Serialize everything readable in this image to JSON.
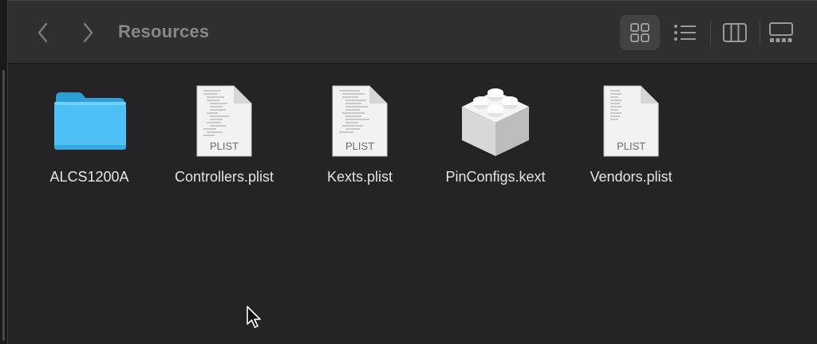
{
  "window": {
    "title": "Resources"
  },
  "toolbar": {
    "back_icon": "chevron-left-icon",
    "forward_icon": "chevron-right-icon",
    "view_buttons": [
      {
        "name": "icon-view",
        "icon": "grid-icon",
        "active": true
      },
      {
        "name": "list-view",
        "icon": "list-icon",
        "active": false
      },
      {
        "name": "column-view",
        "icon": "columns-icon",
        "active": false
      },
      {
        "name": "gallery-view",
        "icon": "gallery-icon",
        "active": false
      }
    ]
  },
  "files": [
    {
      "name": "ALCS1200A",
      "kind": "folder",
      "icon": "folder-icon"
    },
    {
      "name": "Controllers.plist",
      "kind": "plist",
      "icon": "plist-document-icon",
      "tag": "PLIST"
    },
    {
      "name": "Kexts.plist",
      "kind": "plist",
      "icon": "plist-document-icon",
      "tag": "PLIST"
    },
    {
      "name": "PinConfigs.kext",
      "kind": "kext",
      "icon": "kext-bundle-icon"
    },
    {
      "name": "Vendors.plist",
      "kind": "plist",
      "icon": "plist-document-icon",
      "tag": "PLIST"
    }
  ],
  "colors": {
    "background": "#262326",
    "toolbar": "#312e31",
    "folder": "#4fc0f5",
    "label_text": "#e6e4e6",
    "title_text": "#8a878a"
  }
}
